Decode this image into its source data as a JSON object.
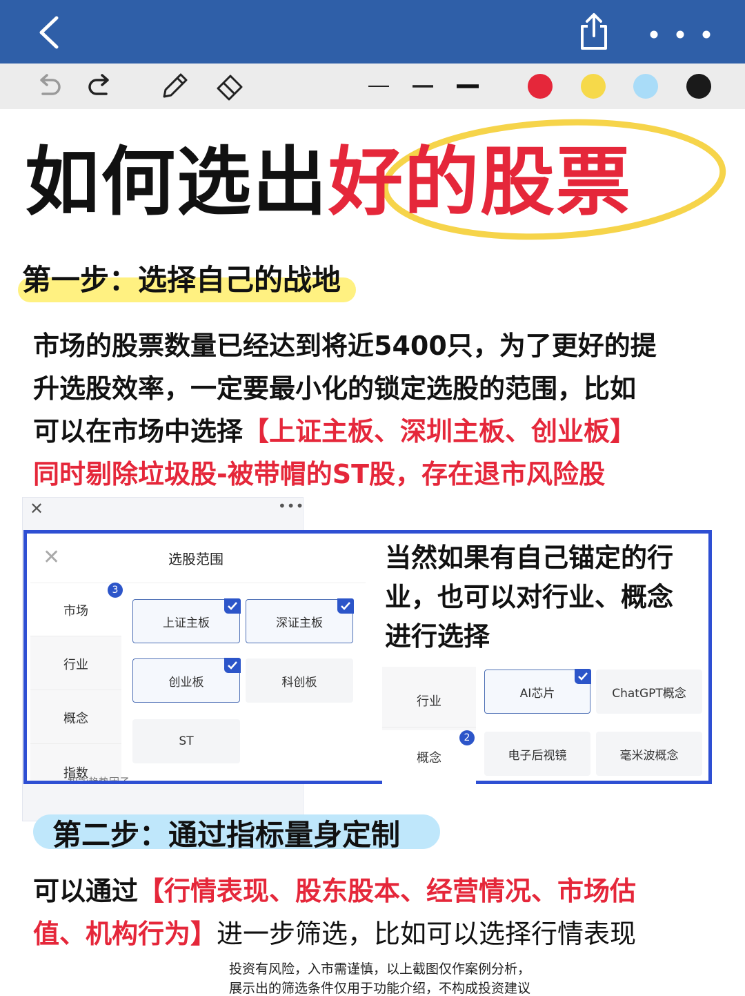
{
  "nav": {
    "back_icon": "chevron-left-icon",
    "share_icon": "share-icon",
    "more_icon": "more-horizontal-icon",
    "bar_color": "#2f5fa8"
  },
  "toolbar": {
    "tools": [
      "undo-icon",
      "redo-icon",
      "pencil-icon",
      "eraser-icon"
    ],
    "line_widths": [
      "thin",
      "medium",
      "thick"
    ],
    "colors": [
      "#e5273a",
      "#f6d94a",
      "#a9dcf8",
      "#1a1a1a"
    ]
  },
  "title": {
    "black_part": "如何选出",
    "red_part": "好的股票"
  },
  "step1": {
    "heading": "第一步：选择自己的战地",
    "line1": "市场的股票数量已经达到将近5400只，为了更好的提",
    "line2": "升选股效率，一定要最小化的锁定选股的范围，比如",
    "line3_black": "可以在市场中选择",
    "line3_red": "【上证主板、深圳主板、创业板】",
    "line4_red": "同时剔除垃圾股-被带帽的ST股，存在退市风险股"
  },
  "panel": {
    "modal_title": "选股范围",
    "side_items": [
      "市场",
      "行业",
      "概念",
      "指数"
    ],
    "market_badge": "3",
    "chips": [
      {
        "label": "上证主板",
        "selected": true
      },
      {
        "label": "深证主板",
        "selected": true
      },
      {
        "label": "创业板",
        "selected": true
      },
      {
        "label": "科创板",
        "selected": false
      },
      {
        "label": "ST",
        "selected": false
      }
    ],
    "overlap_text": "智能趋势因子",
    "right_text": [
      "当然如果有自己锚定的行",
      "业，也可以对行业、概念",
      "进行选择"
    ],
    "side2_items": [
      "行业",
      "概念"
    ],
    "concept_badge": "2",
    "concept_chips": [
      {
        "label": "AI芯片",
        "selected": true
      },
      {
        "label": "ChatGPT概念",
        "selected": false
      },
      {
        "label": "电子后视镜",
        "selected": false
      },
      {
        "label": "毫米波概念",
        "selected": false
      }
    ]
  },
  "step2": {
    "heading": "第二步：通过指标量身定制",
    "line1_black": "可以通过",
    "line1_red": "【行情表现、股东股本、经营情况、市场估",
    "line2_red": "值、机构行为】",
    "line2_black": "进一步筛选，比如可以选择行情表现"
  },
  "disclaimer": {
    "line1": "投资有风险，入市需谨慎，以上截图仅作案例分析，",
    "line2": "展示出的筛选条件仅用于功能介绍，不构成投资建议"
  }
}
